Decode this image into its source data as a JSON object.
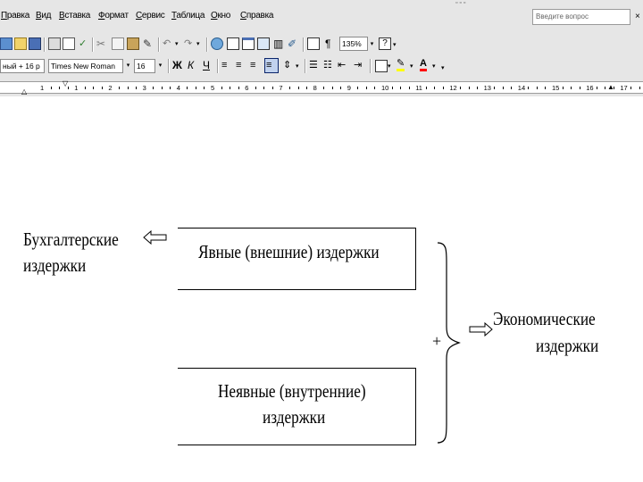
{
  "menu": {
    "items": [
      "Правка",
      "Вид",
      "Вставка",
      "Формат",
      "Сервис",
      "Таблица",
      "Окно",
      "Справка"
    ],
    "ask_placeholder": "Введите вопрос",
    "close_glyph": "×"
  },
  "toolbar": {
    "zoom": "135%",
    "zoom_arrow": "▾",
    "style_value": "ный + 16 p",
    "font_value": "Times New Roman",
    "size_value": "16",
    "bold_label": "Ж",
    "italic_label": "К",
    "underline_label": "Ч",
    "pilcrow": "¶",
    "help_glyph": "?",
    "font_color_letter": "A"
  },
  "ruler": {
    "numbers": [
      "1",
      "1",
      "2",
      "3",
      "4",
      "5",
      "6",
      "7",
      "8",
      "9",
      "10",
      "11",
      "12",
      "13",
      "14",
      "15",
      "16",
      "17"
    ]
  },
  "document": {
    "left_label_line1": "Бухгалтерские",
    "left_label_line2": "издержки",
    "box_top_text": "Явные (внешние) издержки",
    "box_bottom_line1": "Неявные (внутренние)",
    "box_bottom_line2": "издержки",
    "plus_sign": "+",
    "right_label_line1": "Экономические",
    "right_label_line2": "издержки"
  },
  "colors": {
    "chrome": "#e6e6e6",
    "highlight": "#ffff00",
    "font_color": "#ff0000"
  }
}
